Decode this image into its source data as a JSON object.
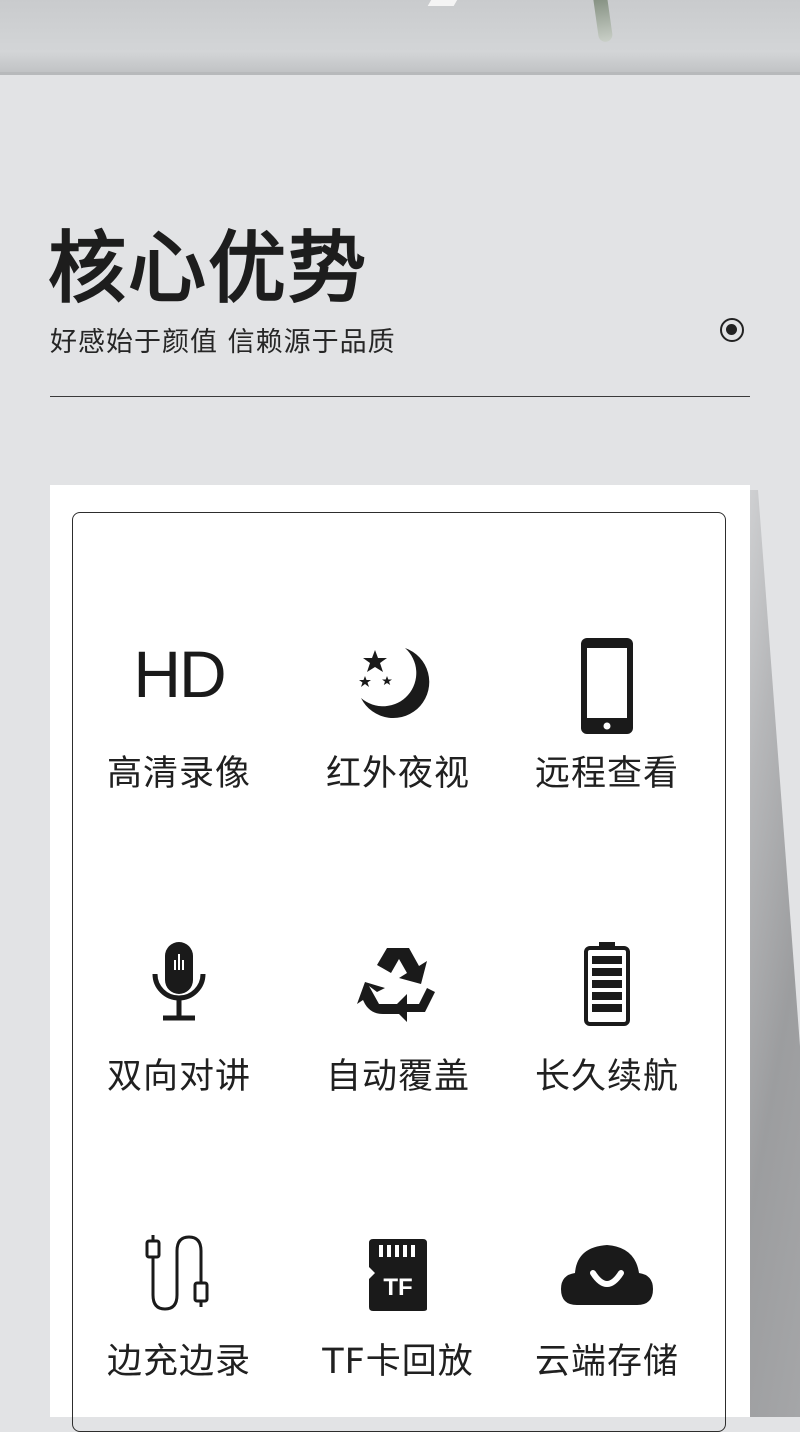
{
  "header": {
    "title": "核心优势",
    "subtitle": "好感始于颜值 信赖源于品质"
  },
  "features": [
    {
      "label": "高清录像",
      "icon": "hd-icon",
      "icon_text": "HD"
    },
    {
      "label": "红外夜视",
      "icon": "moon-stars-icon"
    },
    {
      "label": "远程查看",
      "icon": "smartphone-icon"
    },
    {
      "label": "双向对讲",
      "icon": "microphone-icon"
    },
    {
      "label": "自动覆盖",
      "icon": "recycle-icon"
    },
    {
      "label": "长久续航",
      "icon": "battery-icon"
    },
    {
      "label": "边充边录",
      "icon": "usb-cable-icon"
    },
    {
      "label": "TF卡回放",
      "icon": "tf-card-icon",
      "icon_text": "TF"
    },
    {
      "label": "云端存储",
      "icon": "cloud-smile-icon"
    }
  ],
  "colors": {
    "background": "#e2e3e5",
    "card": "#ffffff",
    "ink": "#1c1c1c"
  }
}
